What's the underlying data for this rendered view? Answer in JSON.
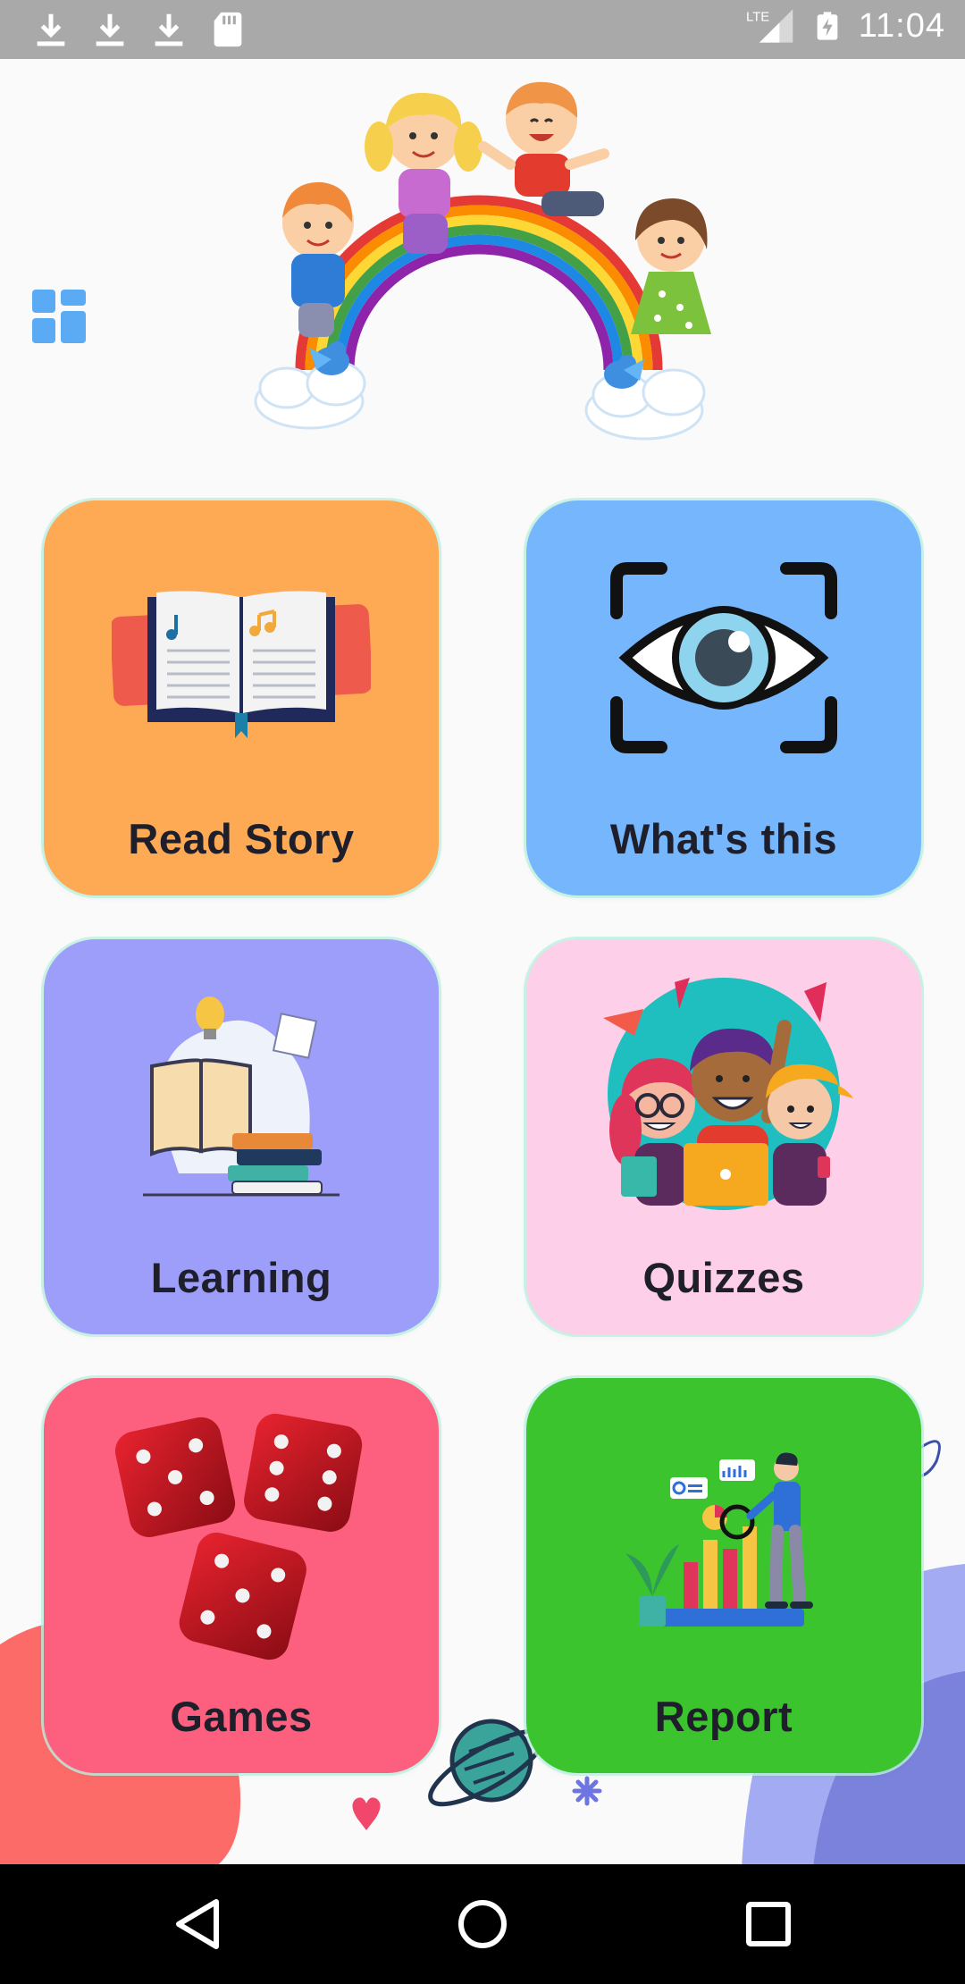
{
  "status_bar": {
    "time": "11:04",
    "network": "LTE",
    "left_icons": [
      "download-icon",
      "download-icon",
      "download-icon",
      "sd-card-icon"
    ],
    "right_icons": [
      "signal-icon",
      "battery-charging-icon"
    ]
  },
  "header": {
    "menu_icon": "grid-menu-icon",
    "hero_image": "kids-on-rainbow-illustration"
  },
  "tiles": [
    {
      "label": "Read Story",
      "icon": "open-book-icon",
      "color": "#fea954"
    },
    {
      "label": "What's this",
      "icon": "eye-scan-icon",
      "color": "#76b6fd"
    },
    {
      "label": "Learning",
      "icon": "books-lightbulb-icon",
      "color": "#9d9ef9"
    },
    {
      "label": "Quizzes",
      "icon": "happy-kids-icon",
      "color": "#fdcfe8"
    },
    {
      "label": "Games",
      "icon": "dice-icon",
      "color": "#fd5f7e"
    },
    {
      "label": "Report",
      "icon": "analytics-chart-icon",
      "color": "#3bc42e"
    }
  ],
  "nav_bar": {
    "back_icon": "back-triangle-icon",
    "home_icon": "home-circle-icon",
    "recent_icon": "recent-apps-square-icon"
  }
}
